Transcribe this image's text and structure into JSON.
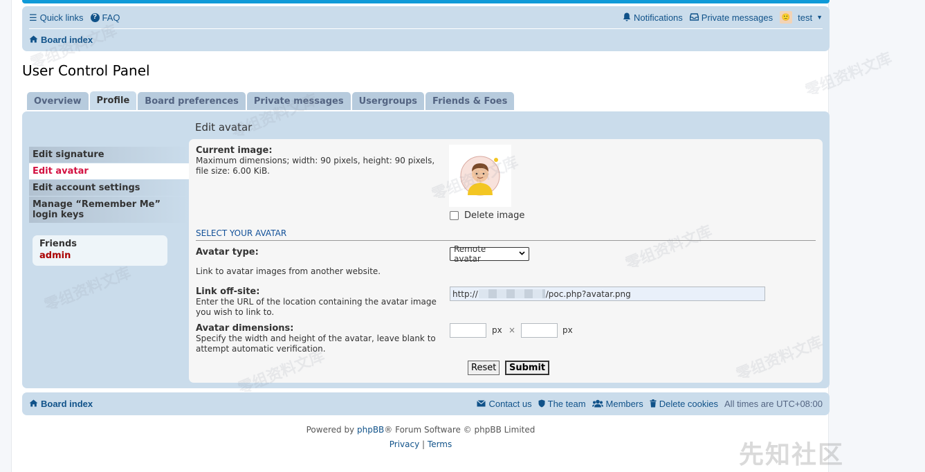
{
  "header": {
    "quick_links": "Quick links",
    "faq": "FAQ",
    "notifications": "Notifications",
    "private_messages": "Private messages",
    "username": "test",
    "board_index": "Board index"
  },
  "page_title": "User Control Panel",
  "tabs": [
    {
      "label": "Overview"
    },
    {
      "label": "Profile"
    },
    {
      "label": "Board preferences"
    },
    {
      "label": "Private messages"
    },
    {
      "label": "Usergroups"
    },
    {
      "label": "Friends & Foes"
    }
  ],
  "active_tab": "Profile",
  "sidebar": {
    "items": [
      {
        "label": "Edit signature"
      },
      {
        "label": "Edit avatar"
      },
      {
        "label": "Edit account settings"
      },
      {
        "label": "Manage “Remember Me” login keys"
      }
    ],
    "active_item": "Edit avatar",
    "friends": {
      "title": "Friends",
      "user": "admin"
    }
  },
  "content": {
    "title": "Edit avatar",
    "current_image_label": "Current image:",
    "current_image_desc": "Maximum dimensions; width: 90 pixels, height: 90 pixels, file size: 6.00 KiB.",
    "delete_image_label": "Delete image",
    "section_heading": "SELECT YOUR AVATAR",
    "avatar_type_label": "Avatar type:",
    "avatar_type_value": "Remote avatar",
    "avatar_type_desc": "Link to avatar images from another website.",
    "link_offsite_label": "Link off-site:",
    "link_offsite_desc": "Enter the URL of the location containing the avatar image you wish to link to.",
    "link_prefix": "http://",
    "link_suffix": "/poc.php?avatar.png",
    "dimensions_label": "Avatar dimensions:",
    "dimensions_desc": "Specify the width and height of the avatar, leave blank to attempt automatic verification.",
    "px_unit": "px",
    "times": "×",
    "reset_button": "Reset",
    "submit_button": "Submit"
  },
  "footer": {
    "board_index": "Board index",
    "contact_us": "Contact us",
    "the_team": "The team",
    "members": "Members",
    "delete_cookies": "Delete cookies",
    "timezone": "All times are UTC+08:00",
    "powered_prefix": "Powered by ",
    "phpbb": "phpBB",
    "powered_suffix": "® Forum Software © phpBB Limited",
    "privacy": "Privacy",
    "separator": "|",
    "terms": "Terms"
  },
  "watermark_text": "零组资料文库",
  "corner_logo": "先知社区",
  "colors": {
    "link": "#105289",
    "panel": "#cadceb",
    "active_side": "#d31141",
    "accent": "#0f9ad8"
  }
}
